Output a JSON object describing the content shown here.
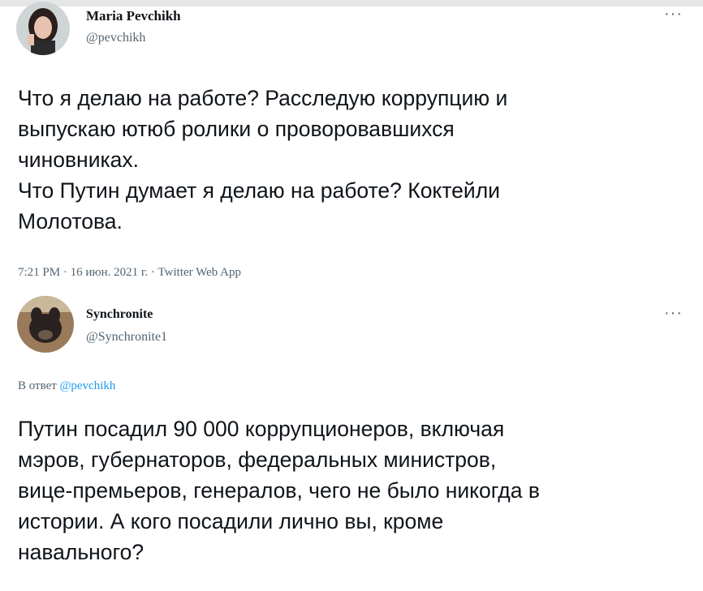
{
  "tweet1": {
    "name": "Maria Pevchikh",
    "handle": "@pevchikh",
    "text": "Что я делаю на работе? Расследую коррупцию и\nвыпускаю ютюб ролики о проворовавшихся\nчиновниках.\nЧто Путин думает я делаю на работе? Коктейли\nМолотова.",
    "meta": "7:21 PM · 16 июн. 2021 г. · Twitter Web App",
    "more_icon": "more-horizontal-icon"
  },
  "tweet2": {
    "name": "Synchronite",
    "handle": "@Synchronite1",
    "reply_prefix": "В ответ",
    "reply_to": "@pevchikh",
    "text": "Путин посадил 90 000 коррупционеров, включая\nмэров, губернаторов, федеральных министров,\nвице-премьеров, генералов, чего не было никогда в\nистории. А кого посадили лично вы, кроме\nнавального?",
    "more_icon": "more-horizontal-icon"
  }
}
